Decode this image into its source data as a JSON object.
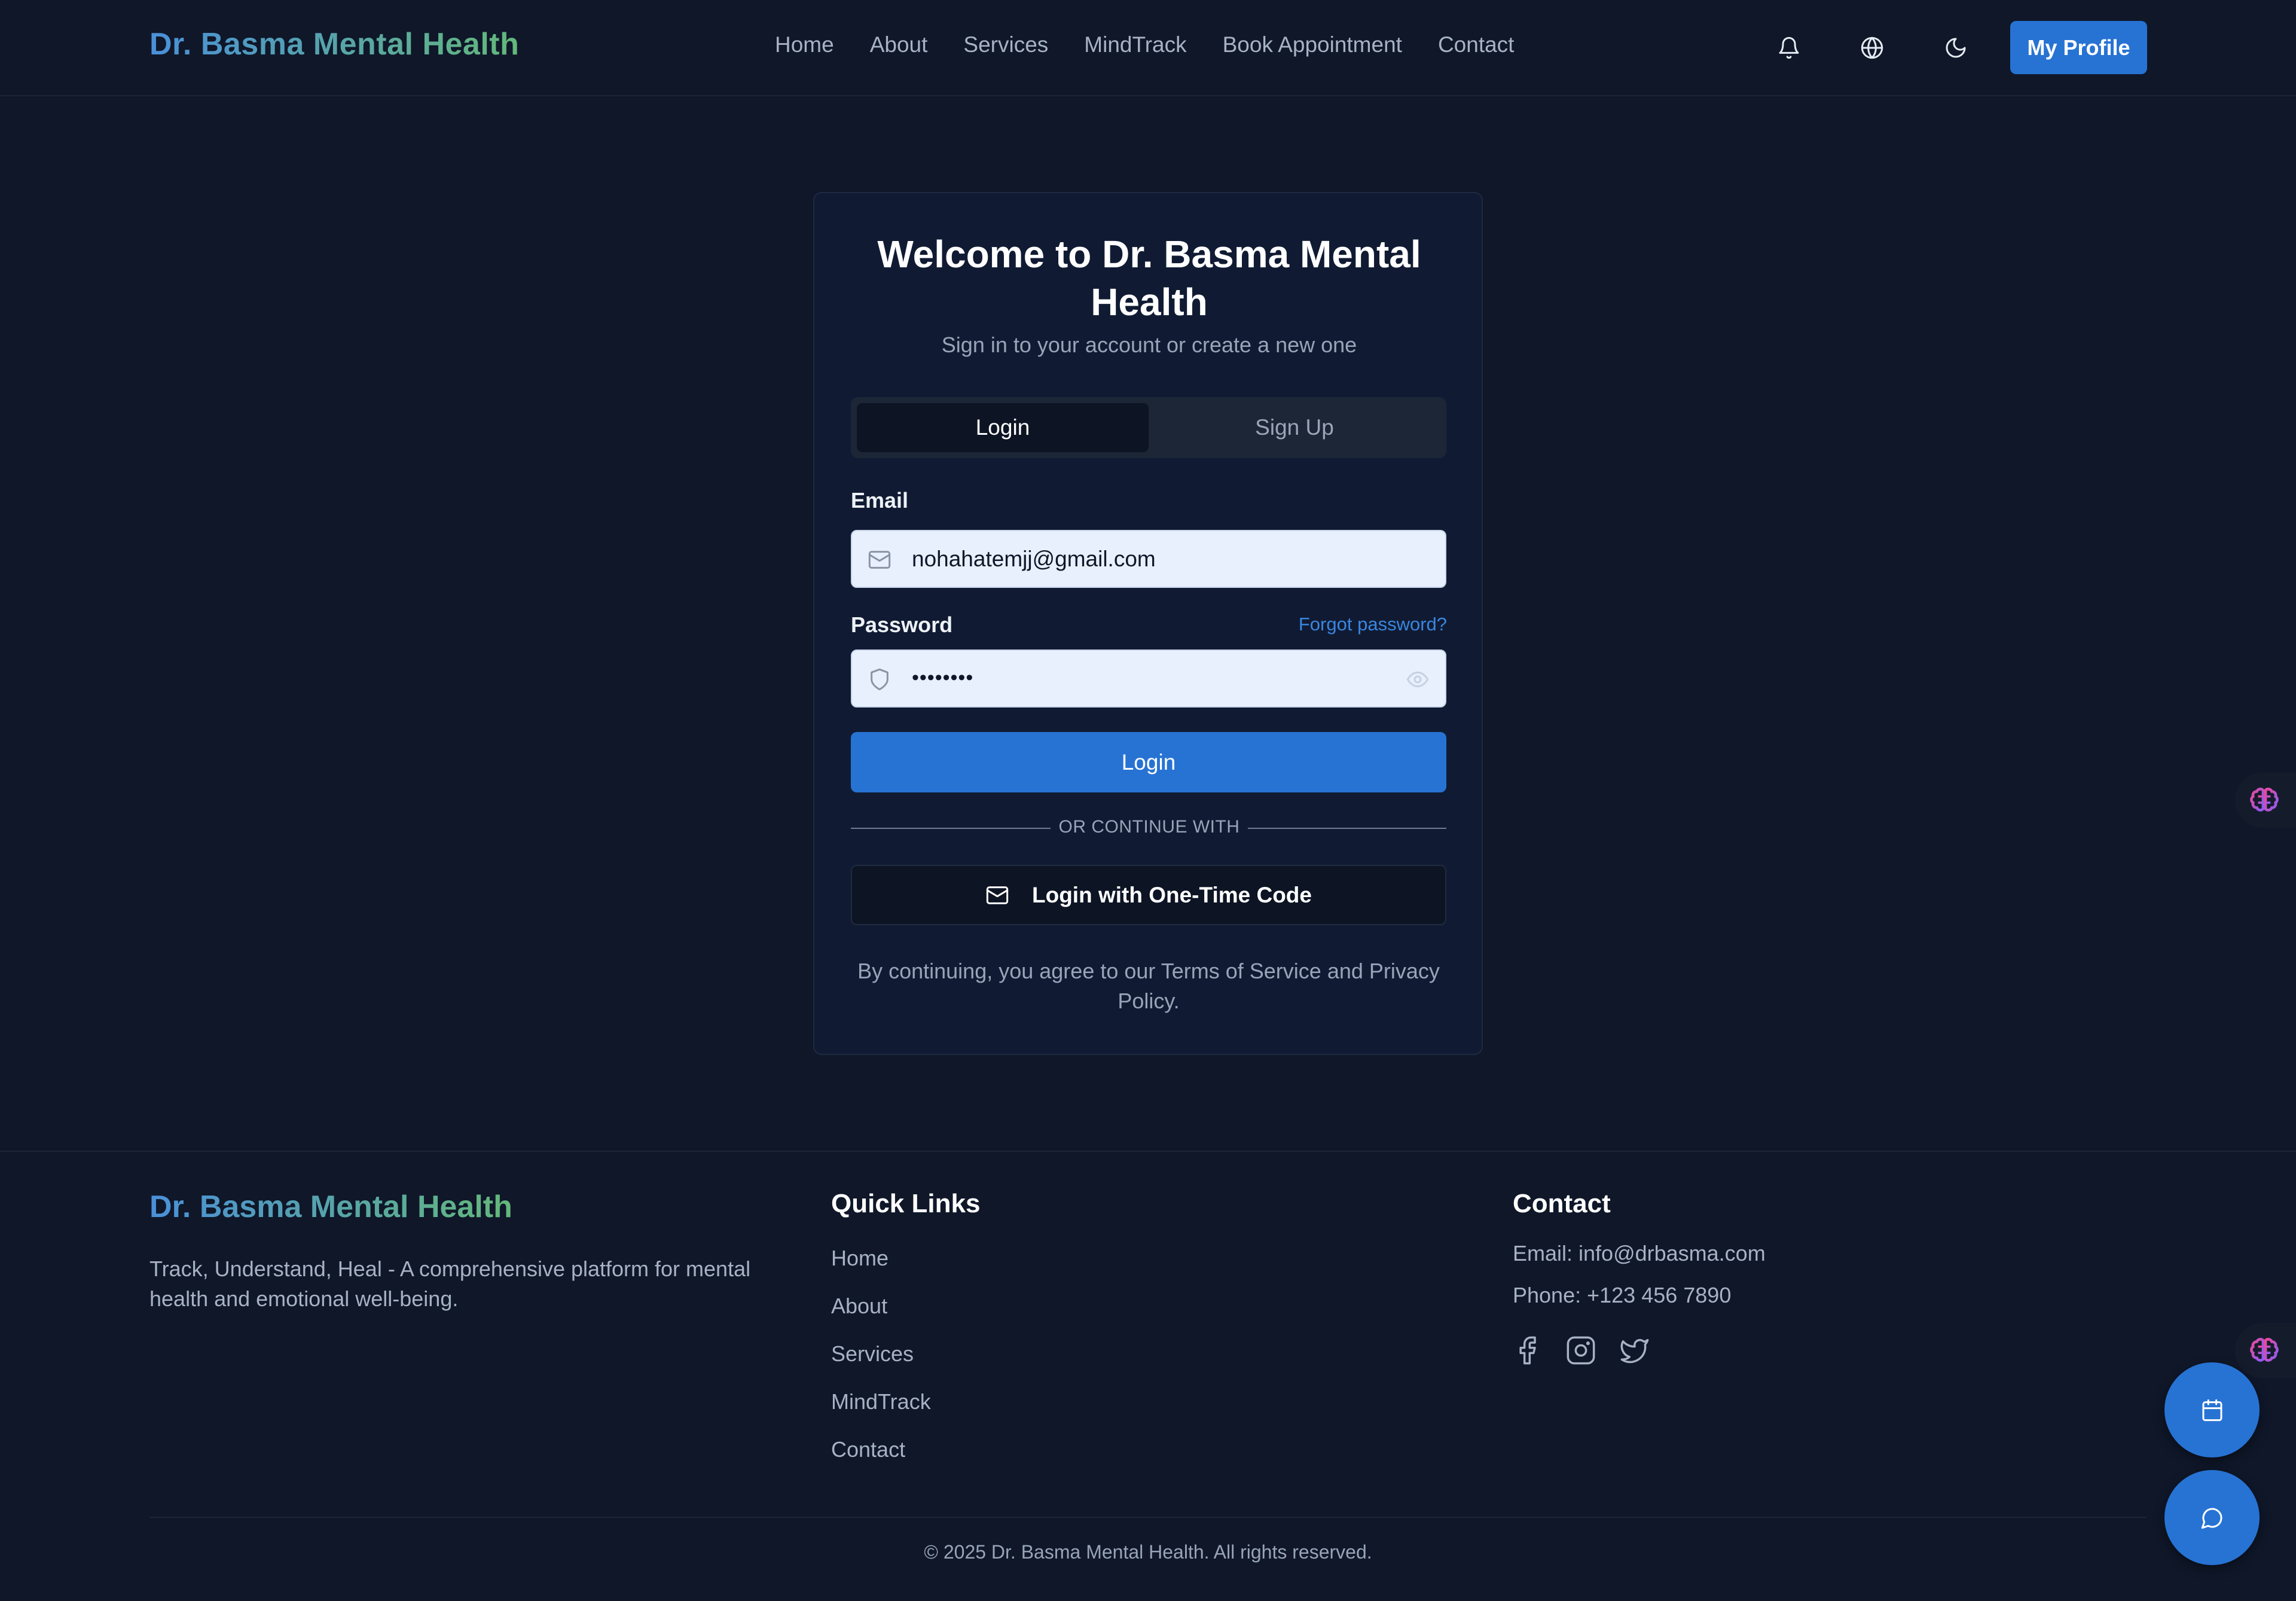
{
  "header": {
    "brand": "Dr. Basma Mental Health",
    "nav": [
      "Home",
      "About",
      "Services",
      "MindTrack",
      "Book Appointment",
      "Contact"
    ],
    "profile_button": "My Profile",
    "icons": [
      "bell-icon",
      "globe-icon",
      "moon-icon"
    ]
  },
  "auth": {
    "title": "Welcome to Dr. Basma Mental Health",
    "subtitle": "Sign in to your account or create a new one",
    "tabs": {
      "login": "Login",
      "signup": "Sign Up",
      "active": "Login"
    },
    "email_label": "Email",
    "email_value": "nohahatemjj@gmail.com",
    "password_label": "Password",
    "password_value": "••••••••",
    "forgot_link": "Forgot password?",
    "login_button": "Login",
    "divider": "OR CONTINUE WITH",
    "otp_button": "Login with One-Time Code",
    "terms": "By continuing, you agree to our Terms of Service and Privacy Policy."
  },
  "footer": {
    "brand": "Dr. Basma Mental Health",
    "description": "Track, Understand, Heal - A comprehensive platform for mental health and emotional well-being.",
    "quick_links_heading": "Quick Links",
    "quick_links": [
      "Home",
      "About",
      "Services",
      "MindTrack",
      "Contact"
    ],
    "contact_heading": "Contact",
    "email": "Email: info@drbasma.com",
    "phone": "Phone: +123 456 7890",
    "social_icons": [
      "facebook-icon",
      "instagram-icon",
      "twitter-icon"
    ],
    "copyright": "© 2025 Dr. Basma Mental Health. All rights reserved."
  },
  "floating": {
    "side_tabs": [
      "brain-icon",
      "brain-icon"
    ],
    "fabs": [
      "calendar-icon",
      "chat-icon"
    ]
  },
  "colors": {
    "background": "#0f1729",
    "card": "#101b33",
    "accent": "#2773d4",
    "brand_gradient_start": "#4a90d9",
    "brand_gradient_end": "#64b87a",
    "input_bg": "#e8f0fd",
    "link": "#3a86e0"
  }
}
